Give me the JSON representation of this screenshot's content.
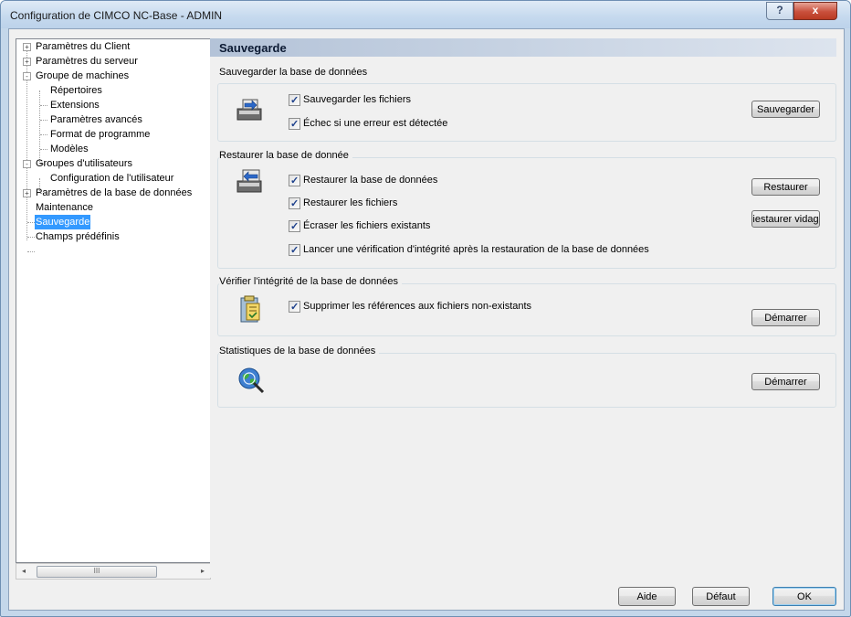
{
  "window": {
    "title": "Configuration de CIMCO NC-Base - ADMIN",
    "help_glyph": "?",
    "close_glyph": "x"
  },
  "tree": {
    "items": [
      {
        "label": "Paramètres du Client",
        "expander": "+"
      },
      {
        "label": "Paramètres du serveur",
        "expander": "+"
      },
      {
        "label": "Groupe de machines",
        "expander": "-"
      },
      {
        "label": "Répertoires"
      },
      {
        "label": "Extensions"
      },
      {
        "label": "Paramètres avancés"
      },
      {
        "label": "Format de programme"
      },
      {
        "label": "Modèles"
      },
      {
        "label": "Groupes d'utilisateurs",
        "expander": "-"
      },
      {
        "label": "Configuration de l'utilisateur"
      },
      {
        "label": "Paramètres de la base de données",
        "expander": "+"
      },
      {
        "label": "Maintenance"
      },
      {
        "label": "Sauvegarde",
        "selected": true
      },
      {
        "label": "Champs prédéfinis"
      }
    ],
    "scroll_left": "◂",
    "scroll_right": "▸",
    "scroll_grip": "III"
  },
  "panel": {
    "title": "Sauvegarde",
    "backup": {
      "title": "Sauvegarder la base de données",
      "check1": "Sauvegarder les fichiers",
      "check2": "Échec si une erreur est détectée",
      "button": "Sauvegarder"
    },
    "restore": {
      "title": "Restaurer la base de donnée",
      "check1": "Restaurer la base de données",
      "check2": "Restaurer les fichiers",
      "check3": "Écraser les fichiers existants",
      "check4": "Lancer une vérification d'intégrité après la restauration de la base de données",
      "button1": "Restaurer",
      "button2": "iestaurer vidag"
    },
    "integrity": {
      "title": "Vérifier l'intégrité de la base de données",
      "check1": "Supprimer les références aux fichiers non-existants",
      "button": "Démarrer"
    },
    "stats": {
      "title": "Statistiques de la base de données",
      "button": "Démarrer"
    }
  },
  "footer": {
    "help": "Aide",
    "default": "Défaut",
    "ok": "OK"
  }
}
